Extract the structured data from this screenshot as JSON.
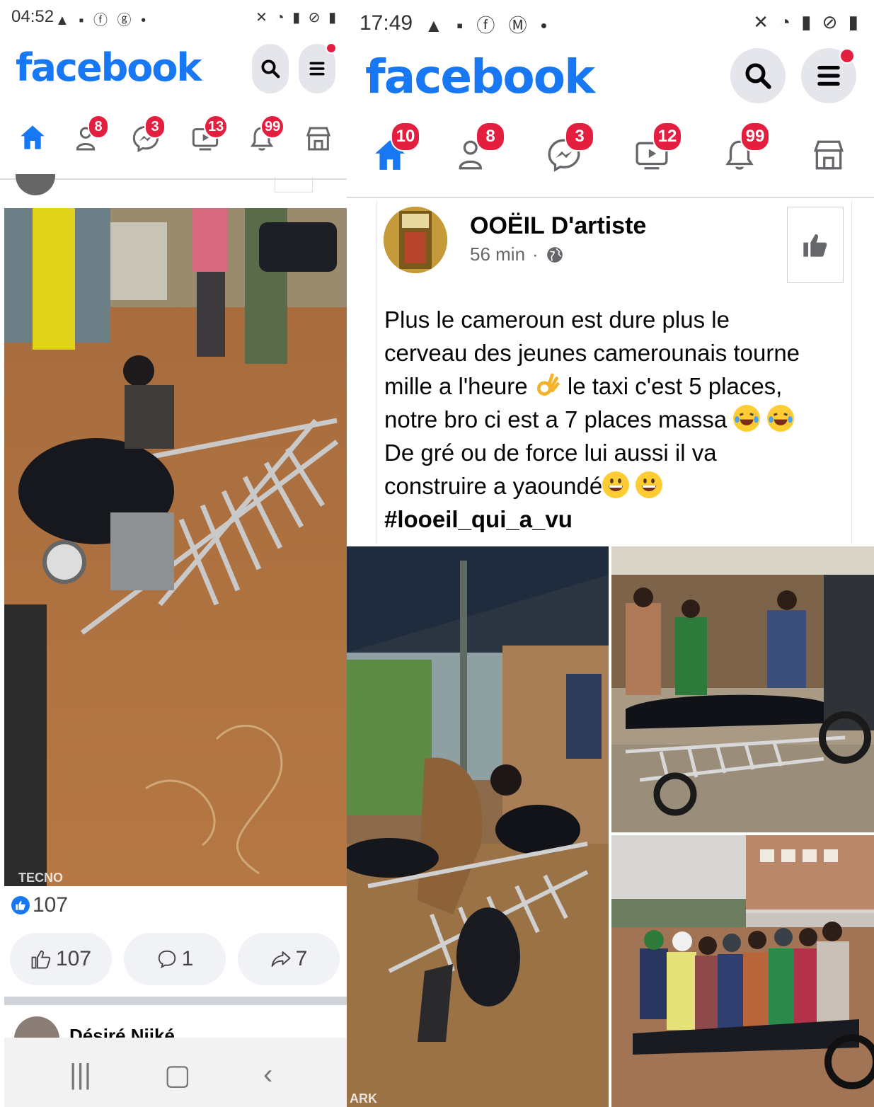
{
  "left_phone": {
    "status": {
      "time": "04:52"
    },
    "header": {
      "logo": "facebook"
    },
    "nav": {
      "friends_badge": "8",
      "messenger_badge": "3",
      "watch_badge": "13",
      "notifications_badge": "99"
    },
    "post": {
      "reaction_count": "107",
      "like_count": "107",
      "comment_count": "1",
      "share_count": "7",
      "photo_watermark": "TECNO"
    },
    "next_post": {
      "author": "Désiré Njiké"
    }
  },
  "right_phone": {
    "status": {
      "time": "17:49"
    },
    "header": {
      "logo": "facebook"
    },
    "nav": {
      "home_badge": "10",
      "friends_badge": "8",
      "messenger_badge": "3",
      "watch_badge": "12",
      "notifications_badge": "99"
    },
    "post": {
      "author": "OOËIL D'artiste",
      "time": "56 min",
      "separator": "·",
      "lines": [
        "Plus le cameroun est dure plus le",
        "cerveau des jeunes camerounais tourne",
        "mille a l'heure",
        "le taxi c'est 5 places,",
        "notre bro ci est a 7 places massa",
        "De gré ou de force lui aussi il va",
        "construire a yaoundé"
      ],
      "hashtag": "#looeil_qui_a_vu",
      "photo_watermark": "ARK"
    }
  },
  "colors": {
    "brand": "#1877f2",
    "badge": "#e41e3f",
    "button_bg": "#e4e6eb",
    "secondary_text": "#65676b"
  }
}
